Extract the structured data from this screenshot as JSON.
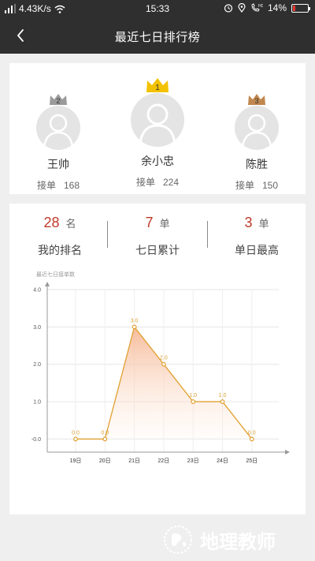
{
  "status_bar": {
    "network_speed": "4.43K/s",
    "time": "15:33",
    "battery": "14%",
    "battery_level": 0.14
  },
  "nav": {
    "title": "最近七日排行榜"
  },
  "podium": [
    {
      "rank": "1",
      "name": "余小忠",
      "orders_label": "接单",
      "orders": "224",
      "crown_color": "#f2c200"
    },
    {
      "rank": "2",
      "name": "王帅",
      "orders_label": "接单",
      "orders": "168",
      "crown_color": "#9a9a9a"
    },
    {
      "rank": "3",
      "name": "陈胜",
      "orders_label": "接单",
      "orders": "150",
      "crown_color": "#c1874f"
    }
  ],
  "stats": [
    {
      "value": "28",
      "unit": "名",
      "label": "我的排名"
    },
    {
      "value": "7",
      "unit": "单",
      "label": "七日累计"
    },
    {
      "value": "3",
      "unit": "单",
      "label": "单日最高"
    }
  ],
  "accent_color": "#c0392b",
  "chart_data": {
    "type": "line",
    "title": "最近七日接单数",
    "categories": [
      "19日",
      "20日",
      "21日",
      "22日",
      "23日",
      "24日",
      "25日"
    ],
    "values": [
      0,
      0,
      3,
      2,
      1,
      1,
      0
    ],
    "data_labels": [
      "0.0",
      "0.0",
      "3.0",
      "2.0",
      "1.0",
      "1.0",
      "0.0"
    ],
    "yticks": [
      4,
      3,
      2,
      1,
      0
    ],
    "ytick_labels": [
      "4.0",
      "3.0",
      "2.0",
      "1.0",
      "-0.0"
    ],
    "ylim": [
      -0.35,
      4
    ],
    "line_color": "#e0a030",
    "grid": true
  },
  "watermark": {
    "text": "地理教师"
  }
}
